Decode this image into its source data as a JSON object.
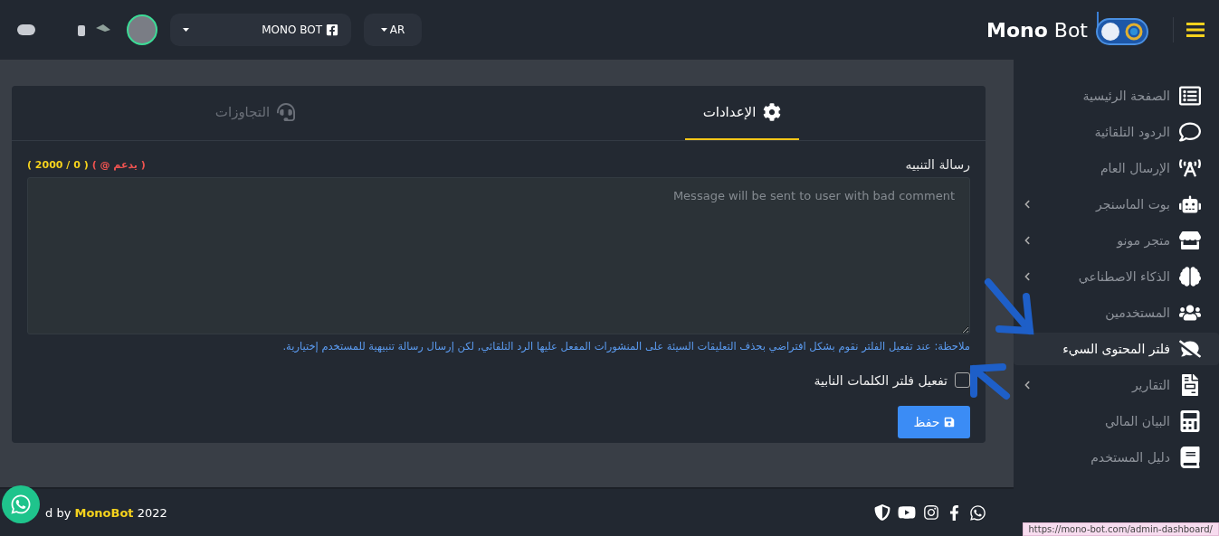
{
  "topbar": {
    "page_selector": {
      "label": "MONO BOT"
    },
    "language": {
      "label": "AR"
    },
    "logo": {
      "bold": "Mono",
      "light": "Bot"
    }
  },
  "sidebar": {
    "items": [
      {
        "label": "الصفحة الرئيسية",
        "kind": "list",
        "has_submenu": false,
        "selected": false
      },
      {
        "label": "الردود التلقائية",
        "kind": "comment",
        "has_submenu": false,
        "selected": false
      },
      {
        "label": "الإرسال العام",
        "kind": "tower",
        "has_submenu": false,
        "selected": false
      },
      {
        "label": "بوت الماسنجر",
        "kind": "robot",
        "has_submenu": true,
        "selected": false
      },
      {
        "label": "متجر مونو",
        "kind": "store",
        "has_submenu": true,
        "selected": false
      },
      {
        "label": "الذكاء الاصطناعي",
        "kind": "brain",
        "has_submenu": true,
        "selected": false
      },
      {
        "label": "المستخدمين",
        "kind": "users",
        "has_submenu": false,
        "selected": false
      },
      {
        "label": "فلتر المحتوى السيء",
        "kind": "filter",
        "has_submenu": false,
        "selected": true
      },
      {
        "label": "التقارير",
        "kind": "report",
        "has_submenu": true,
        "selected": false
      },
      {
        "label": "البيان المالي",
        "kind": "calculator",
        "has_submenu": false,
        "selected": false
      },
      {
        "label": "دليل المستخدم",
        "kind": "guide",
        "has_submenu": false,
        "selected": false
      }
    ]
  },
  "tabs": [
    {
      "label": "الإعدادات",
      "kind": "gear",
      "selected": true
    },
    {
      "label": "التجاوزات",
      "kind": "headset",
      "selected": false
    }
  ],
  "form": {
    "label": "رسالة التنبيه",
    "supports": "( يدعم @ )",
    "counter": "( 2000 / 0 )",
    "placeholder": "Message will be sent to user with bad comment",
    "note": "ملاحظة: عند تفعيل الفلتر نقوم بشكل افتراضي بحذف التعليقات السيئة على المنشورات المفعل عليها الرد التلقائي, لكن إرسال رسالة تنبيهية للمستخدم إختيارية.",
    "checkbox": {
      "label": "تفعيل فلتر الكلمات النابية",
      "checked": false
    },
    "save_button": "حفظ"
  },
  "footer": {
    "credit": "d by **MonoBot** 2022",
    "status_url": "https://mono-bot.com/admin-dashboard/"
  }
}
